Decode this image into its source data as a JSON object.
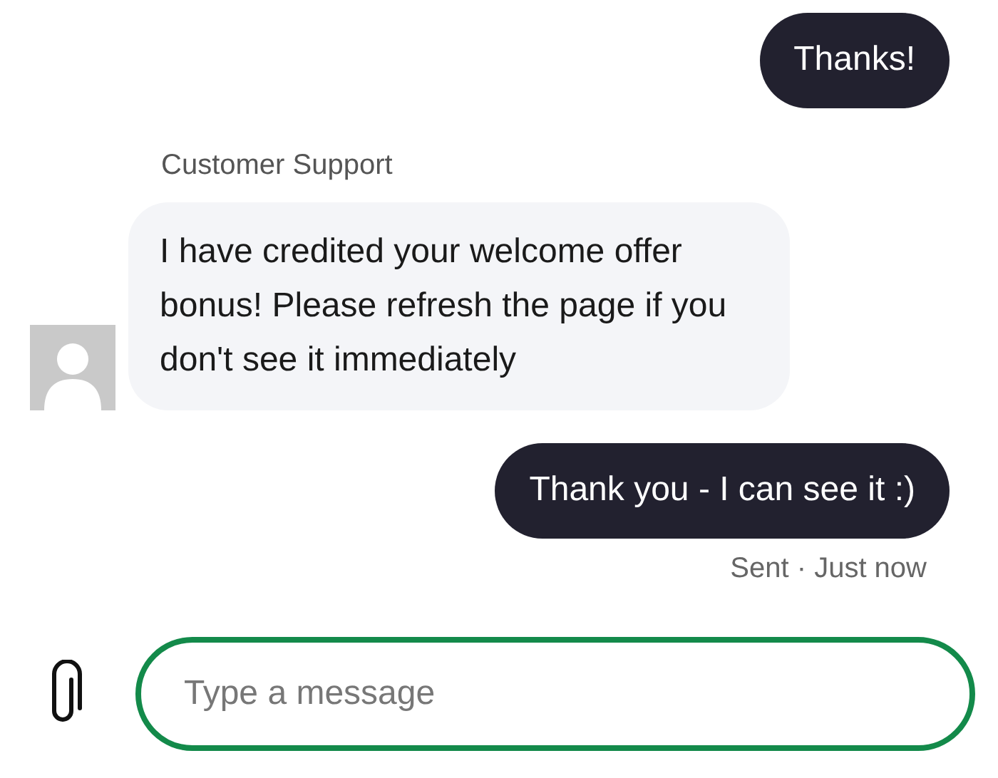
{
  "messages": [
    {
      "kind": "outgoing",
      "text": "Thanks!"
    },
    {
      "kind": "incoming",
      "sender": "Customer Support",
      "text": "I have credited your welcome offer bonus! Please refresh the page if you don't see it immediately"
    },
    {
      "kind": "outgoing",
      "text": "Thank you - I can see it :)",
      "status": "Sent · Just now"
    }
  ],
  "composer": {
    "placeholder": "Type a message",
    "focused": true
  }
}
